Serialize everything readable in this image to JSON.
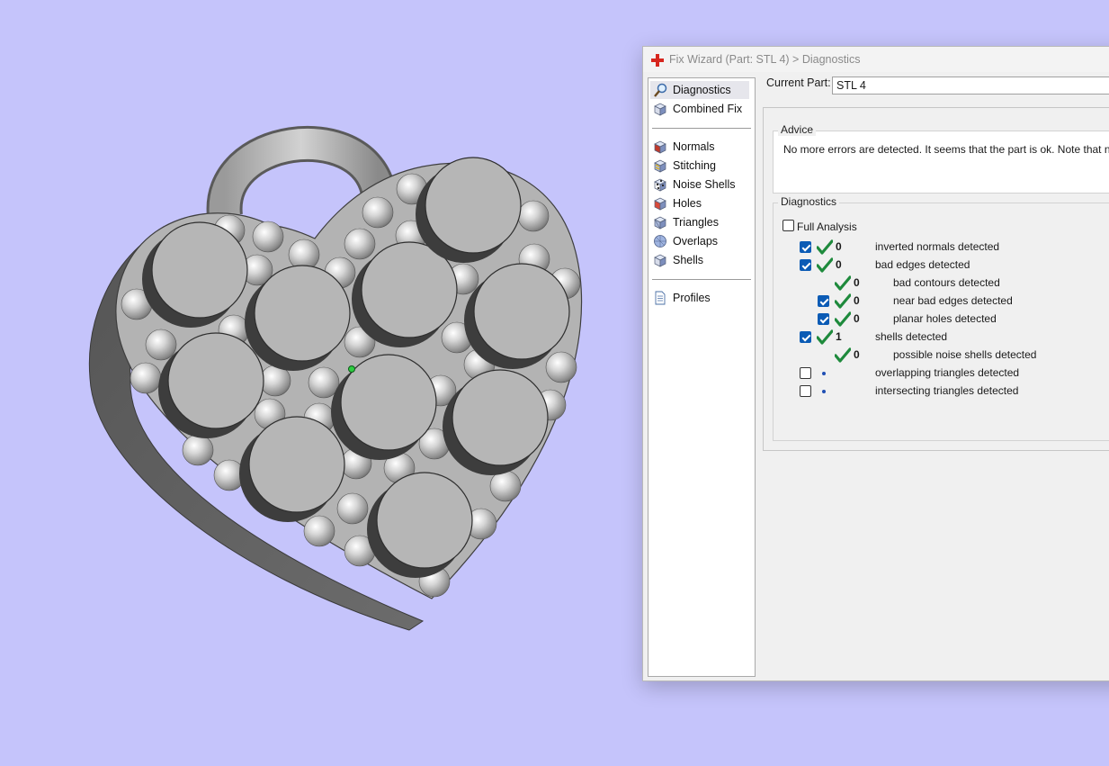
{
  "dialog": {
    "title": "Fix Wizard (Part: STL 4) > Diagnostics",
    "nav_items": [
      {
        "label": "Diagnostics",
        "icon": "magnifier-icon",
        "selected": true
      },
      {
        "label": "Combined Fix",
        "icon": "cube-icon"
      },
      {
        "label": "Normals",
        "icon": "normals-cube-icon"
      },
      {
        "label": "Stitching",
        "icon": "stitching-cube-icon"
      },
      {
        "label": "Noise Shells",
        "icon": "noise-shells-icon"
      },
      {
        "label": "Holes",
        "icon": "holes-cube-icon"
      },
      {
        "label": "Triangles",
        "icon": "triangles-cube-icon"
      },
      {
        "label": "Overlaps",
        "icon": "overlaps-sphere-icon"
      },
      {
        "label": "Shells",
        "icon": "shells-cube-icon"
      },
      {
        "label": "Profiles",
        "icon": "document-icon"
      }
    ],
    "current_part_label": "Current Part:",
    "current_part_value": "STL 4",
    "advice": {
      "title": "Advice",
      "text": "No more errors are detected. It seems that the part is ok. Note that not all p"
    },
    "diagnostics": {
      "title": "Diagnostics",
      "full_analysis_label": "Full Analysis",
      "full_analysis_checked": false,
      "rows": [
        {
          "checked": true,
          "status": "ok",
          "count": "0",
          "label": "inverted normals detected",
          "indent": 0
        },
        {
          "checked": true,
          "status": "ok",
          "count": "0",
          "label": "bad edges detected",
          "indent": 0
        },
        {
          "checkbox": false,
          "status": "ok",
          "count": "0",
          "label": "bad contours detected",
          "indent": 1
        },
        {
          "checked": true,
          "status": "ok",
          "count": "0",
          "label": "near bad edges detected",
          "indent": 1
        },
        {
          "checked": true,
          "status": "ok",
          "count": "0",
          "label": "planar holes detected",
          "indent": 1
        },
        {
          "checked": true,
          "status": "ok",
          "count": "1",
          "label": "shells detected",
          "indent": 0
        },
        {
          "checkbox": false,
          "status": "ok",
          "count": "0",
          "label": "possible noise shells detected",
          "indent": 1
        },
        {
          "checked": false,
          "status": "pending",
          "count": "",
          "label": "overlapping triangles detected",
          "indent": 0
        },
        {
          "checked": false,
          "status": "pending",
          "count": "",
          "label": "intersecting triangles detected",
          "indent": 0
        }
      ]
    }
  },
  "colors": {
    "background": "#c5c4fb",
    "check_green": "#1e8a3c",
    "checkbox_blue": "#0b5bb5",
    "model_face": "#b4b4b4",
    "model_side": "#5c5c5c"
  }
}
